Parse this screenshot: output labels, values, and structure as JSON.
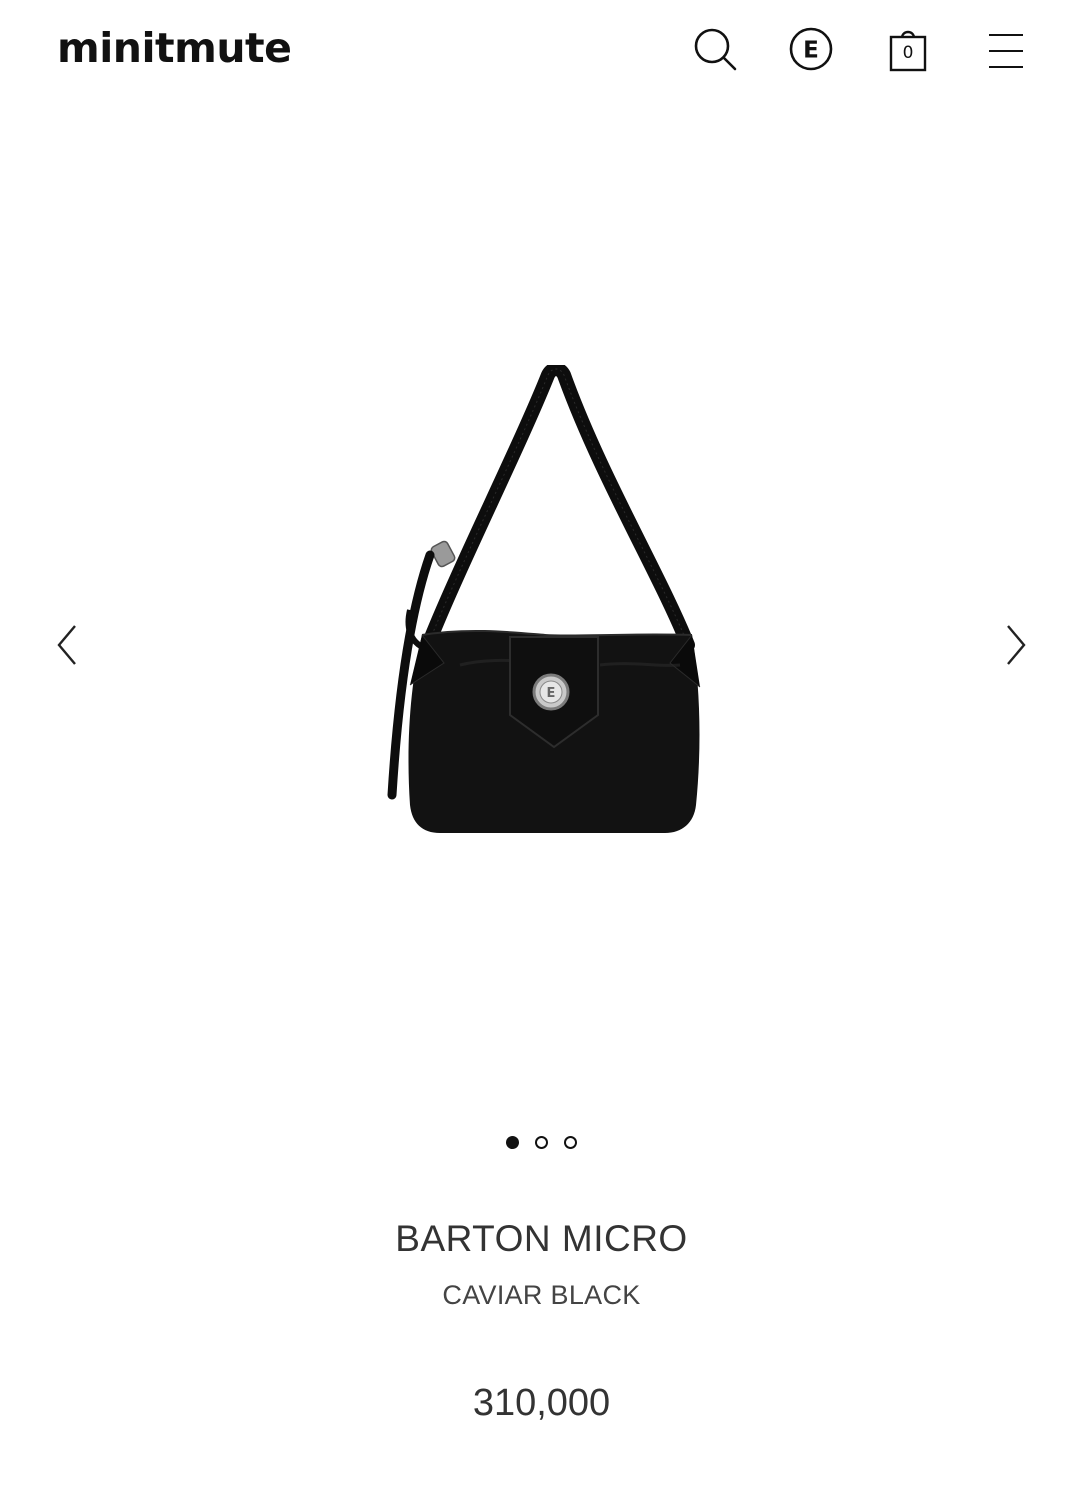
{
  "header": {
    "logo": "minitmute",
    "cart_count": "0",
    "emblem_letter": "E"
  },
  "gallery": {
    "slides_total": 3,
    "active_slide": 1,
    "product_image": "black-leather-shoulder-bag",
    "badge_letter": "E"
  },
  "product": {
    "name": "BARTON MICRO",
    "color": "CAVIAR BLACK",
    "price": "310,000"
  },
  "icons": {
    "search": "search-icon",
    "brand": "brand-emblem-icon",
    "cart": "shopping-bag-icon",
    "menu": "hamburger-menu-icon",
    "prev": "chevron-left-icon",
    "next": "chevron-right-icon"
  }
}
